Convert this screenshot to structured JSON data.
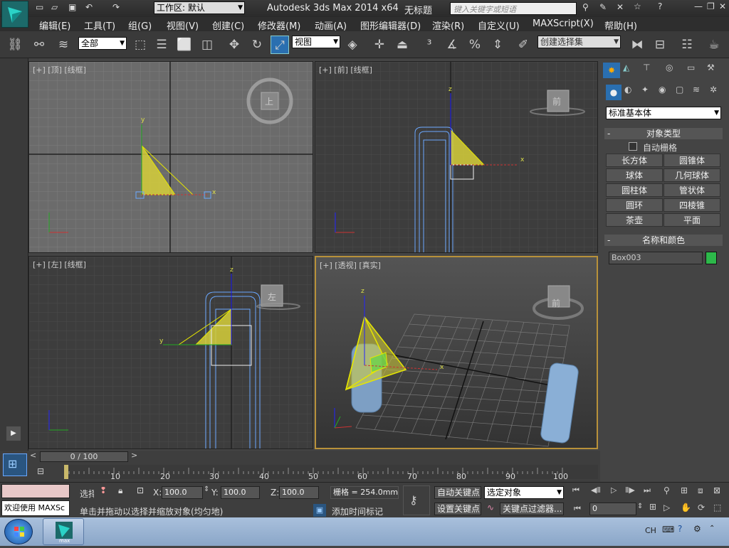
{
  "title_bar": {
    "workspace_label": "工作区: 默认",
    "app_title": "Autodesk 3ds Max  2014 x64",
    "doc_title": "无标题",
    "search_placeholder": "键入关键字或短语"
  },
  "menu": [
    "编辑(E)",
    "工具(T)",
    "组(G)",
    "视图(V)",
    "创建(C)",
    "修改器(M)",
    "动画(A)",
    "图形编辑器(D)",
    "渲染(R)",
    "自定义(U)",
    "MAXScript(X)",
    "帮助(H)"
  ],
  "toolbar": {
    "filter_value": "全部",
    "ref_coord_value": "视图",
    "selection_set_value": "创建选择集"
  },
  "viewports": {
    "top": {
      "label": "[+] [顶] [线框]",
      "cube_face": "上"
    },
    "front": {
      "label": "[+] [前] [线框]",
      "cube_face": "前"
    },
    "left": {
      "label": "[+] [左] [线框]",
      "cube_face": "左"
    },
    "persp": {
      "label": "[+] [透视] [真实]",
      "cube_face": "前"
    }
  },
  "command_panel": {
    "category_value": "标准基本体",
    "object_type_title": "对象类型",
    "autogrid_label": "自动栅格",
    "buttons": [
      "长方体",
      "圆锥体",
      "球体",
      "几何球体",
      "圆柱体",
      "管状体",
      "圆环",
      "四棱锥",
      "茶壶",
      "平面"
    ],
    "name_color_title": "名称和颜色",
    "object_name": "Box003",
    "object_color": "#2db84a"
  },
  "timeline": {
    "frame_counter": "0 / 100",
    "ruler_labels": [
      "10",
      "20",
      "30",
      "40",
      "50",
      "60",
      "70",
      "80",
      "90",
      "100"
    ]
  },
  "status": {
    "listener_text": "欢迎使用 MAXSc",
    "selected_label": "选择",
    "x_label": "X:",
    "x_value": "100.0",
    "y_label": "Y:",
    "y_value": "100.0",
    "z_label": "Z:",
    "z_value": "100.0",
    "grid_label": "栅格 = 254.0mm",
    "auto_key": "自动关键点",
    "key_mode_value": "选定对象",
    "set_key": "设置关键点",
    "key_filters": "关键点过滤器...",
    "prompt": "单击并拖动以选择并缩放对象(均匀地)",
    "add_time_tag": "添加时间标记",
    "current_frame": "0"
  },
  "taskbar": {
    "app_label": "max",
    "lang": "CH"
  },
  "colors": {
    "accent": "#2a9fd6",
    "selected_wire": "#e6e600",
    "triangle_fill": "#d6cf3a",
    "box_wire": "#6aa8ff",
    "persp_border": "#b8913a"
  }
}
